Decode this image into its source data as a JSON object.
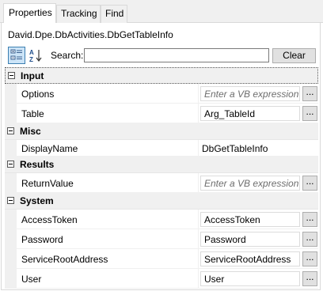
{
  "tabs": [
    {
      "label": "Properties"
    },
    {
      "label": "Tracking"
    },
    {
      "label": "Find"
    }
  ],
  "type_name": "David.Dpe.DbActivities.DbGetTableInfo",
  "toolbar": {
    "categorized_icon": "categorized-view-icon",
    "sort_icon": "sort-alphabetical-icon",
    "sort_glyph": "A Z",
    "search_label": "Search:",
    "search_value": "",
    "clear_label": "Clear"
  },
  "ellipsis_label": "...",
  "categories": [
    {
      "label": "Input",
      "rows": [
        {
          "name": "Options",
          "value": "Enter a VB expression",
          "placeholder": true,
          "editor": true
        },
        {
          "name": "Table",
          "value": "Arg_TableId",
          "placeholder": false,
          "editor": true
        }
      ]
    },
    {
      "label": "Misc",
      "rows": [
        {
          "name": "DisplayName",
          "value": "DbGetTableInfo",
          "placeholder": false,
          "editor": false
        }
      ]
    },
    {
      "label": "Results",
      "rows": [
        {
          "name": "ReturnValue",
          "value": "Enter a VB expression",
          "placeholder": true,
          "editor": true
        }
      ]
    },
    {
      "label": "System",
      "rows": [
        {
          "name": "AccessToken",
          "value": "AccessToken",
          "placeholder": false,
          "editor": true
        },
        {
          "name": "Password",
          "value": "Password",
          "placeholder": false,
          "editor": true
        },
        {
          "name": "ServiceRootAddress",
          "value": "ServiceRootAddress",
          "placeholder": false,
          "editor": true
        },
        {
          "name": "User",
          "value": "User",
          "placeholder": false,
          "editor": true
        }
      ]
    }
  ]
}
